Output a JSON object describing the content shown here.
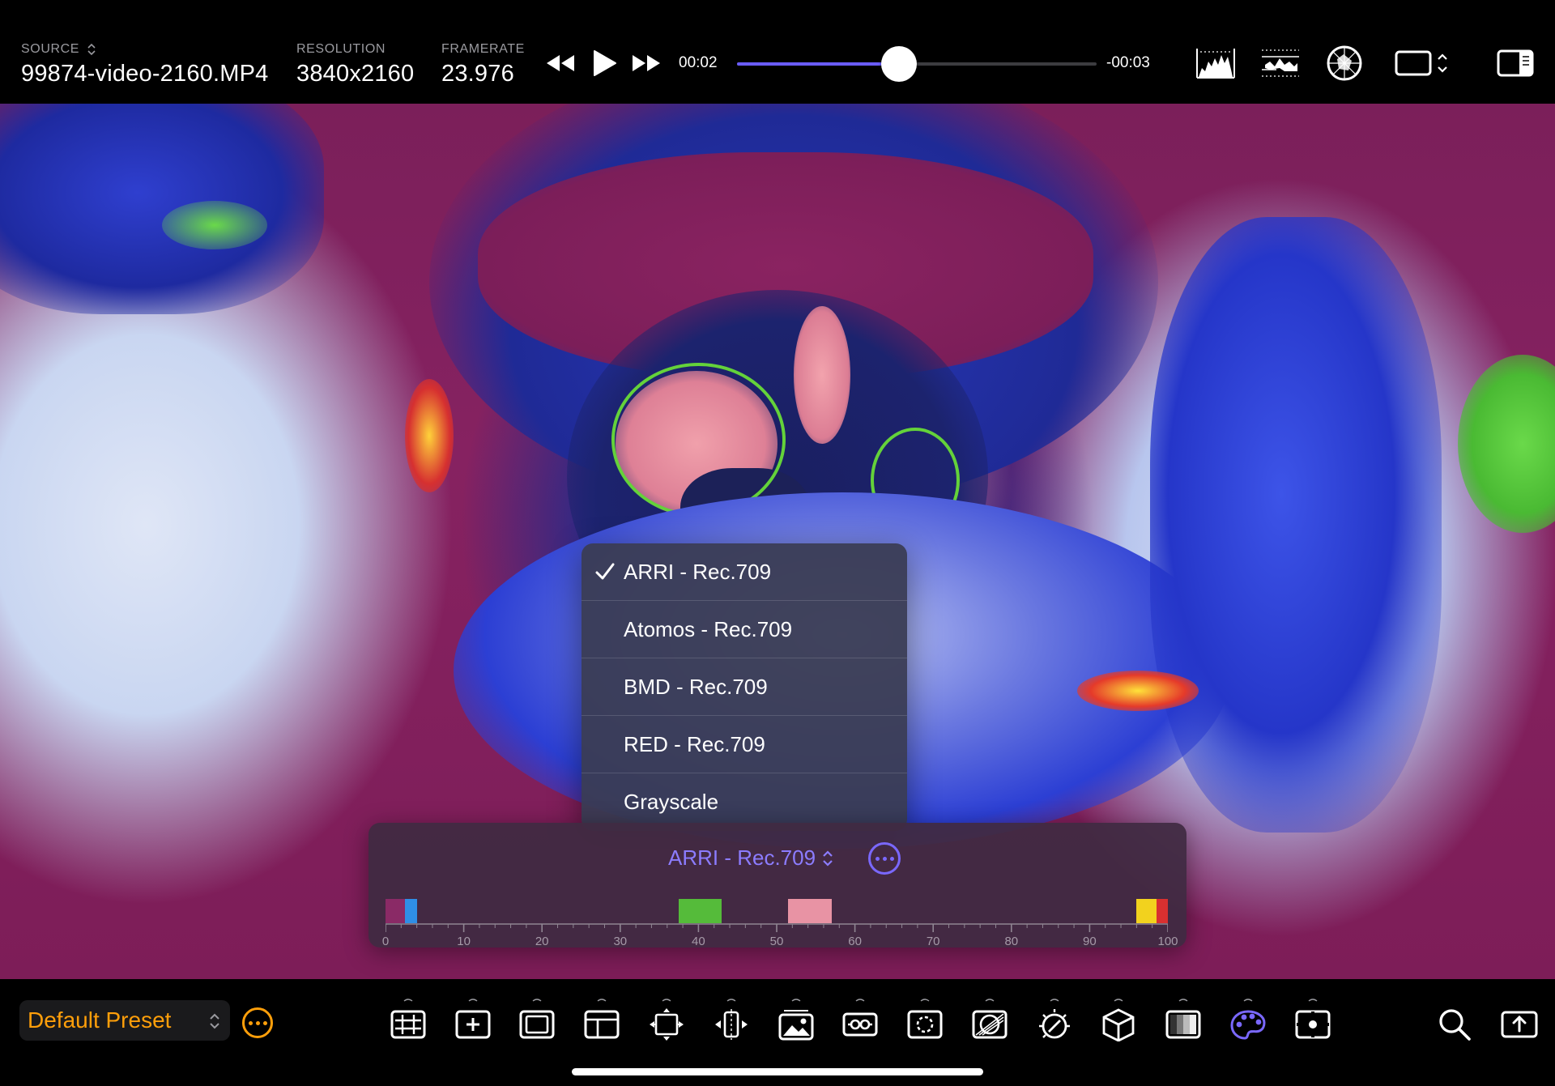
{
  "header": {
    "source_label": "SOURCE",
    "source_value": "99874-video-2160.MP4",
    "resolution_label": "RESOLUTION",
    "resolution_value": "3840x2160",
    "framerate_label": "FRAMERATE",
    "framerate_value": "23.976"
  },
  "transport": {
    "elapsed": "00:02",
    "remaining": "-00:03",
    "progress": 0.45,
    "accent_color": "#6a5cff"
  },
  "top_icons": [
    "histogram-icon",
    "waveform-icon",
    "vectorscope-icon",
    "frame-aspect-icon",
    "sidebar-toggle-icon"
  ],
  "false_color_menu": {
    "items": [
      {
        "label": "ARRI - Rec.709",
        "checked": true
      },
      {
        "label": "Atomos - Rec.709",
        "checked": false
      },
      {
        "label": "BMD - Rec.709",
        "checked": false
      },
      {
        "label": "RED - Rec.709",
        "checked": false
      },
      {
        "label": "Grayscale",
        "checked": false
      }
    ]
  },
  "false_color_panel": {
    "title": "ARRI - Rec.709",
    "accent_color": "#8c7cff",
    "scale_labels": [
      "0",
      "10",
      "20",
      "30",
      "40",
      "50",
      "60",
      "70",
      "80",
      "90",
      "100"
    ],
    "scale_range": [
      0,
      100
    ],
    "bands": [
      {
        "from": 0,
        "to": 2.5,
        "color": "#8a2a66"
      },
      {
        "from": 2.5,
        "to": 4,
        "color": "#2f8ee6"
      },
      {
        "from": 37.5,
        "to": 43,
        "color": "#55bb3a"
      },
      {
        "from": 51.5,
        "to": 57,
        "color": "#e893a4"
      },
      {
        "from": 96,
        "to": 98.5,
        "color": "#f2d21e"
      },
      {
        "from": 98.5,
        "to": 100,
        "color": "#d83030"
      }
    ]
  },
  "footer": {
    "preset_label": "Default Preset",
    "preset_color": "#ff9f0a",
    "tools": [
      "grid-overlay-icon",
      "crosshair-center-icon",
      "safe-area-icon",
      "frame-guide-icon",
      "anamorphic-desqueeze-icon",
      "flip-mirror-icon",
      "image-overlay-icon",
      "focus-peaking-icon",
      "zebra-icon",
      "exposure-compare-icon",
      "anamorphic-lens-icon",
      "lut-cube-icon",
      "gray-ramp-icon",
      "false-color-icon",
      "spot-meter-icon"
    ],
    "active_tool": "false-color-icon",
    "right_icons": [
      "search-icon",
      "share-export-icon"
    ]
  }
}
